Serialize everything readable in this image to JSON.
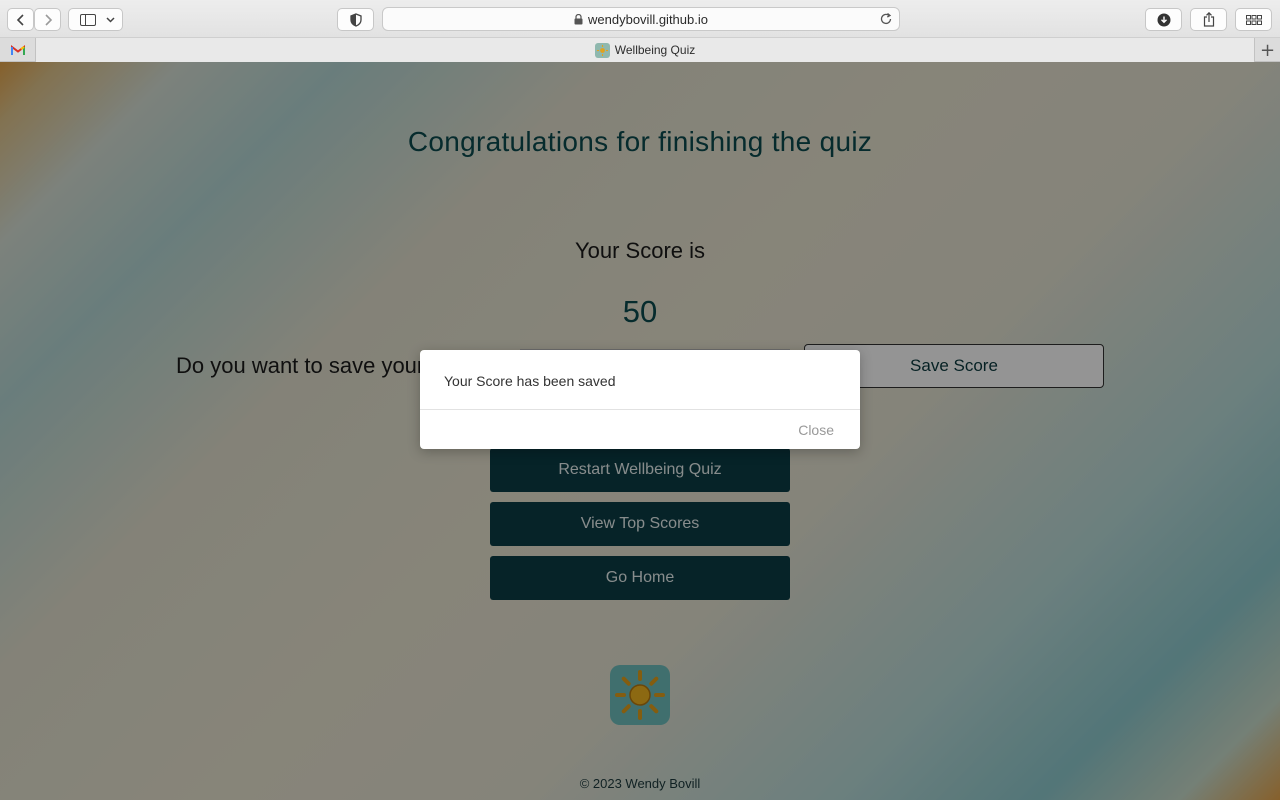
{
  "browser": {
    "url": "wendybovill.github.io",
    "tab_title": "Wellbeing Quiz"
  },
  "page": {
    "heading": "Congratulations for finishing the quiz",
    "score_label": "Your Score is",
    "score_value": "50",
    "save_question": "Do you want to save your score?",
    "save_button": "Save Score",
    "actions": [
      {
        "label": "Restart Wellbeing Quiz"
      },
      {
        "label": "View Top Scores"
      },
      {
        "label": "Go Home"
      }
    ],
    "footer": "© 2023 Wendy Bovill"
  },
  "modal": {
    "message": "Your Score has been saved",
    "close_label": "Close"
  },
  "colors": {
    "accent": "#0b3d45",
    "heading": "#0b4a4f",
    "logo_bg": "#6fbfbd",
    "sun": "#e0a21e"
  }
}
